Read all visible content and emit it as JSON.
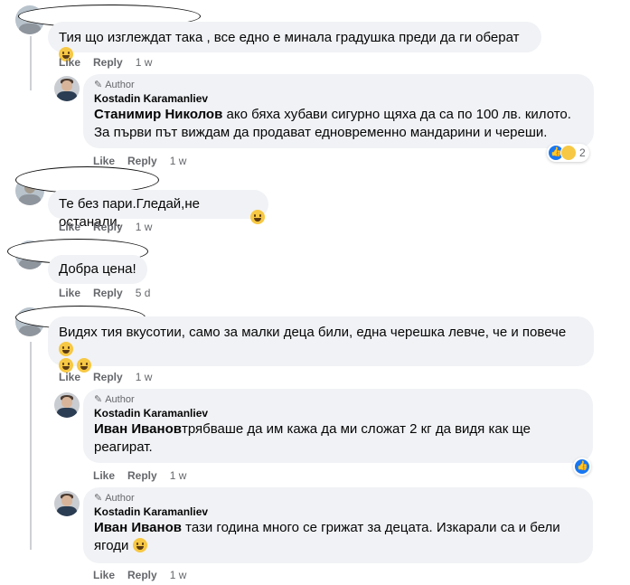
{
  "actions": {
    "like": "Like",
    "reply": "Reply"
  },
  "comments": [
    {
      "text": "Тия що изглеждат така , все едно е минала градушка преди да ги оберат",
      "time": "1 w"
    },
    {
      "author_badge": "Author",
      "author": "Kostadin Karamanliev",
      "mention": "Станимир Николов",
      "text": " ако бяха хубави сигурно щяха да са по 100 лв. килото. За първи път виждам да продават едновременно мандарини и череши.",
      "time": "1 w",
      "reaction_count": "2"
    },
    {
      "text": "Те без пари.Гледай,не останали.",
      "time": "1 w"
    },
    {
      "text": "Добра цена!",
      "time": "5 d"
    },
    {
      "text": "Видях тия вкусотии, само за малки деца били, една черешка левче, че и повече",
      "time": "1 w"
    },
    {
      "author_badge": "Author",
      "author": "Kostadin Karamanliev",
      "mention": "Иван Иванов",
      "text": "трябваше да им кажа да ми сложат 2 кг да видя как ще реагират.",
      "time": "1 w"
    },
    {
      "author_badge": "Author",
      "author": "Kostadin Karamanliev",
      "mention": "Иван Иванов",
      "text": " тази година много се грижат за децата. Изкарали са и бели ягоди",
      "time": "1 w"
    }
  ]
}
